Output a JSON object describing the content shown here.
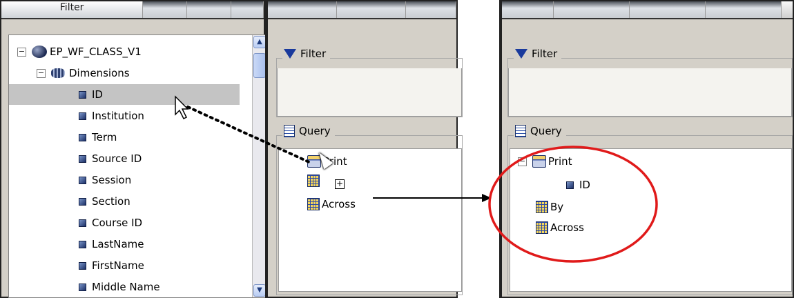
{
  "left": {
    "tabs": [
      "Filter"
    ],
    "tree": {
      "root": "EP_WF_CLASS_V1",
      "dimensions": "Dimensions",
      "items": [
        "ID",
        "Institution",
        "Term",
        "Source ID",
        "Session",
        "Section",
        "Course ID",
        "LastName",
        "FirstName",
        "Middle Name"
      ]
    }
  },
  "middle": {
    "filter_title": "Filter",
    "query_title": "Query",
    "query_items": {
      "print": "Print",
      "across": "Across"
    }
  },
  "right": {
    "filter_title": "Filter",
    "query_title": "Query",
    "query_items": {
      "print": "Print",
      "print_child": "ID",
      "by": "By",
      "across": "Across"
    }
  },
  "annotation_colors": {
    "circle": "#e01a1a",
    "arrow": "#000000"
  },
  "icons": [
    "expand-icon",
    "database-icon",
    "dimensions-icon",
    "dimension-field-icon",
    "filter-funnel-icon",
    "query-document-icon",
    "print-icon",
    "grid-icon",
    "cursor-icon",
    "drop-add-icon"
  ]
}
